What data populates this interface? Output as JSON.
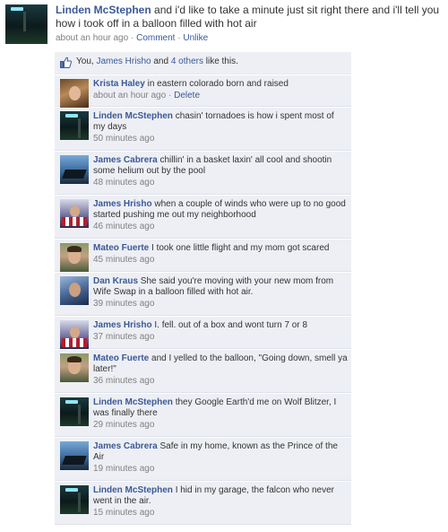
{
  "post": {
    "author": "Linden McStephen",
    "text": "and i'd like to take a minute just sit right there and i'll tell you how i took off in a balloon filled with hot air",
    "time": "about an hour ago",
    "separator": "·",
    "comment_link": "Comment",
    "unlike_link": "Unlike"
  },
  "likes": {
    "prefix": "You,",
    "person": "James Hrisho",
    "and": "and",
    "others": "4 others",
    "suffix": "like this."
  },
  "comments": [
    {
      "author": "Krista Haley",
      "text": "in eastern colorado born and raised",
      "time": "about an hour ago",
      "separator": "·",
      "delete": "Delete"
    },
    {
      "author": "Linden McStephen",
      "text": "chasin' tornadoes is how i spent most of my days",
      "time": "50 minutes ago"
    },
    {
      "author": "James Cabrera",
      "text": "chillin' in a basket laxin' all cool and shootin some helium out by the pool",
      "time": "48 minutes ago"
    },
    {
      "author": "James Hrisho",
      "text": "when a couple of winds who were up to no good started pushing me out my neighborhood",
      "time": "46 minutes ago"
    },
    {
      "author": "Mateo Fuerte",
      "text": "I took one little flight and my mom got scared",
      "time": "45 minutes ago"
    },
    {
      "author": "Dan Kraus",
      "text": "She said you're moving with your new mom from Wife Swap in a balloon filled with hot air.",
      "time": "39 minutes ago"
    },
    {
      "author": "James Hrisho",
      "text": "I. fell. out of a box and wont turn 7 or 8",
      "time": "37 minutes ago"
    },
    {
      "author": "Mateo Fuerte",
      "text": "and I yelled to the balloon, \"Going down, smell ya later!\"",
      "time": "36 minutes ago"
    },
    {
      "author": "Linden McStephen",
      "text": "they Google Earth'd me on Wolf Blitzer, I was finally there",
      "time": "29 minutes ago"
    },
    {
      "author": "James Cabrera",
      "text": "Safe in my home, known as the Prince of the Air",
      "time": "19 minutes ago"
    },
    {
      "author": "Linden McStephen",
      "text": "I hid in my garage, the falcon who never went in the air.",
      "time": "15 minutes ago"
    }
  ],
  "colors": {
    "link": "#3b5998",
    "comment_bg": "#edeff4",
    "meta": "#808080"
  },
  "icons": {
    "like": "thumbs-up-icon"
  }
}
